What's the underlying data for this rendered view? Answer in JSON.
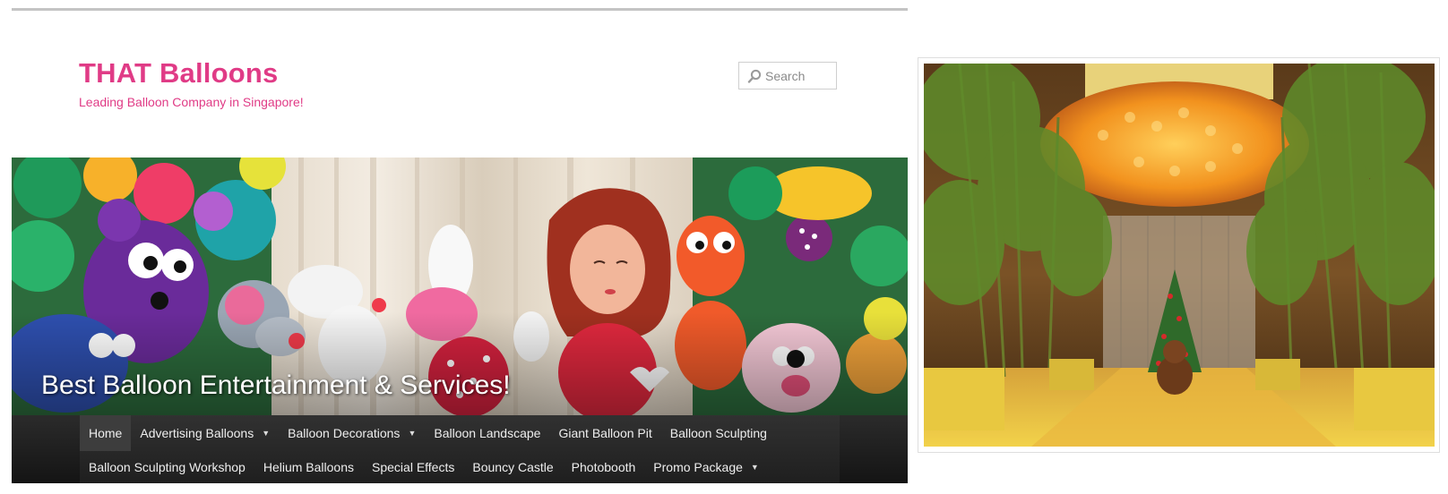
{
  "site": {
    "title": "THAT Balloons",
    "tagline": "Leading Balloon Company in Singapore!"
  },
  "search": {
    "placeholder": "Search",
    "icon": "search-icon"
  },
  "banner": {
    "caption": "Best Balloon Entertainment & Services!"
  },
  "nav": {
    "row1": [
      {
        "label": "Home",
        "active": true
      },
      {
        "label": "Advertising Balloons",
        "dropdown": true
      },
      {
        "label": "Balloon Decorations",
        "dropdown": true
      },
      {
        "label": "Balloon Landscape"
      },
      {
        "label": "Giant Balloon Pit"
      },
      {
        "label": "Balloon Sculpting"
      }
    ],
    "row2": [
      {
        "label": "Balloon Sculpting Workshop"
      },
      {
        "label": "Helium Balloons"
      },
      {
        "label": "Special Effects"
      },
      {
        "label": "Bouncy Castle"
      },
      {
        "label": "Photobooth"
      },
      {
        "label": "Promo Package",
        "dropdown": true
      }
    ],
    "dropdown_glyph": "▼"
  },
  "colors": {
    "brand": "#e03b86",
    "nav_bg": "#222222",
    "nav_text": "#eeeeee"
  }
}
